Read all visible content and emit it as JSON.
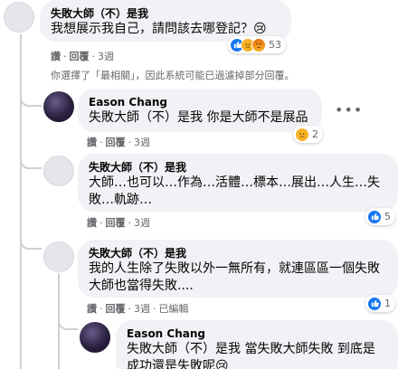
{
  "comments": [
    {
      "author": "失敗大師（不）是我",
      "text": "我想展示我自己，請問該去哪登記？😢",
      "actions": [
        "讚",
        "回覆"
      ],
      "time": "3週",
      "reactions": [
        "like",
        "sad",
        "angry"
      ],
      "reaction_count": "53"
    },
    {
      "author": "Eason Chang",
      "text": "失敗大師（不）是我 你是大師不是展品",
      "actions": [
        "讚",
        "回覆"
      ],
      "time": "3週",
      "reactions": [
        "sad"
      ],
      "reaction_count": "2"
    },
    {
      "author": "失敗大師（不）是我",
      "text": "大師…也可以…作為…活體…標本…展出…人生…失敗…軌跡…",
      "actions": [
        "讚",
        "回覆"
      ],
      "time": "3週",
      "reactions": [
        "like"
      ],
      "reaction_count": "5"
    },
    {
      "author": "失敗大師（不）是我",
      "text": "我的人生除了失敗以外一無所有，就連區區一個失敗大師也當得失敗....",
      "actions": [
        "讚",
        "回覆"
      ],
      "time": "3週",
      "edited": "已編輯",
      "reactions": [
        "like"
      ],
      "reaction_count": "1"
    },
    {
      "author": "Eason Chang",
      "text": "失敗大師（不）是我 當失敗大師失敗 到底是成功還是失敗呢😢"
    }
  ],
  "filter_notice": "你選擇了「最相關」，因此系統可能已過濾掉部分回覆。",
  "more_label": "•••",
  "colors": {
    "like": "#1877f2",
    "sad": "#f7b125",
    "bubble": "#f0f2f5",
    "meta": "#65676b"
  }
}
